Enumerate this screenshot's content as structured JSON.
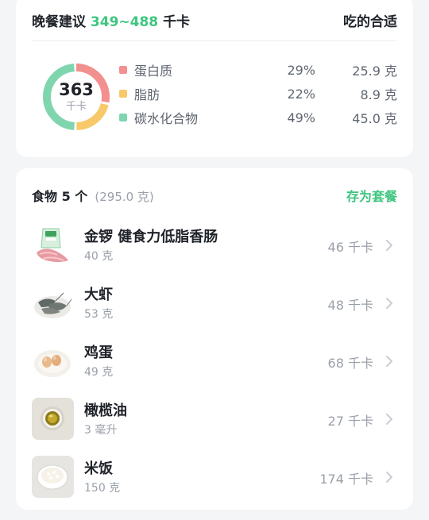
{
  "summary": {
    "title_prefix": "晚餐建议",
    "range": "349~488",
    "unit": "千卡",
    "right_label": "吃的合适",
    "total_kcal": "363",
    "total_unit": "千卡",
    "macros": [
      {
        "name": "蛋白质",
        "percent": "29%",
        "grams": "25.9 克",
        "color": "#f2908f",
        "share": 0.29
      },
      {
        "name": "脂肪",
        "percent": "22%",
        "grams": "8.9 克",
        "color": "#f8c96a",
        "share": 0.22
      },
      {
        "name": "碳水化合物",
        "percent": "49%",
        "grams": "45.0 克",
        "color": "#7fd6ae",
        "share": 0.49
      }
    ]
  },
  "foods": {
    "title": "食物 5 个",
    "total_weight": "(295.0 克)",
    "save_label": "存为套餐",
    "items": [
      {
        "name": "金锣 健食力低脂香肠",
        "amount": "40 克",
        "kcal": "46 千卡",
        "icon": "sausage-pack-icon"
      },
      {
        "name": "大虾",
        "amount": "53 克",
        "kcal": "48 千卡",
        "icon": "shrimp-plate-icon"
      },
      {
        "name": "鸡蛋",
        "amount": "49 克",
        "kcal": "68 千卡",
        "icon": "eggs-plate-icon"
      },
      {
        "name": "橄榄油",
        "amount": "3 毫升",
        "kcal": "27 千卡",
        "icon": "olive-oil-bowl-icon"
      },
      {
        "name": "米饭",
        "amount": "150 克",
        "kcal": "174 千卡",
        "icon": "rice-bowl-icon"
      }
    ]
  }
}
